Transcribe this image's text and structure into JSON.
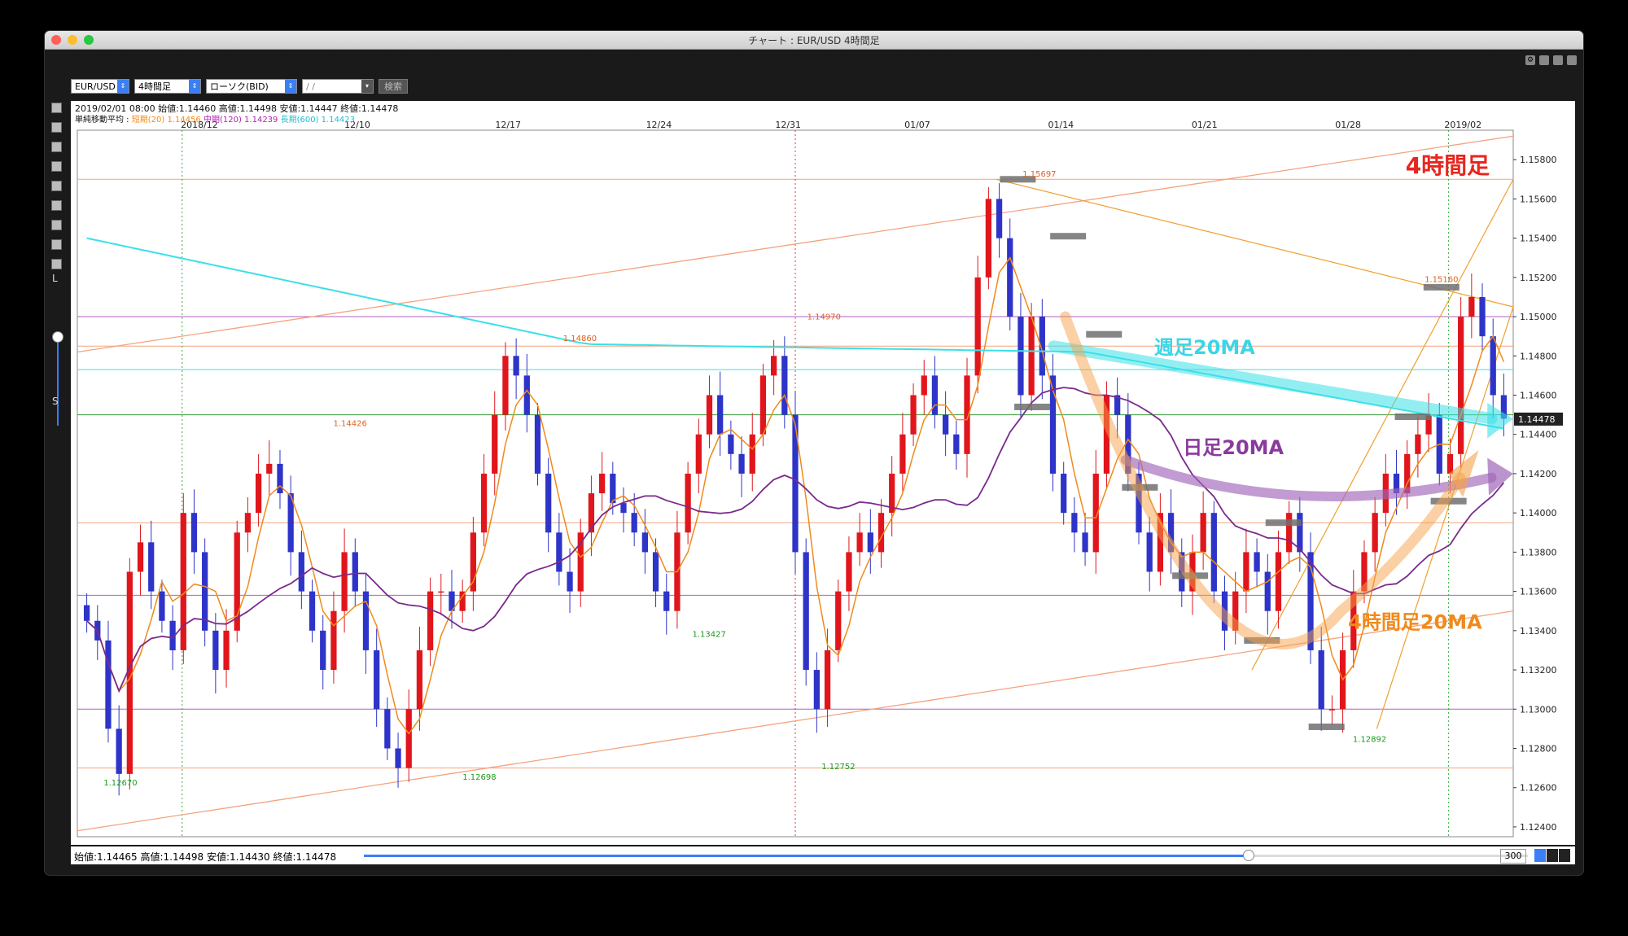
{
  "window": {
    "title": "チャート : EUR/USD 4時間足"
  },
  "toolbar": {
    "symbol": "EUR/USD",
    "timeframe": "4時間足",
    "chart_type": "ローソク(BID)",
    "date_placeholder": "/ /",
    "search_label": "検索"
  },
  "info": {
    "ohlc_line": "2019/02/01 08:00 始値:1.14460 高値:1.14498 安値:1.14447 終値:1.14478",
    "ma_prefix": "単純移動平均 : ",
    "ma_short": "短期(20) 1.14456",
    "ma_mid": "中期(120) 1.14239",
    "ma_long": "長期(600) 1.14423"
  },
  "side": {
    "label_top": "L",
    "label_bottom": "S"
  },
  "bottom": {
    "status": "始値:1.14465 高値:1.14498 安値:1.14430 終値:1.14478",
    "zoom": "300",
    "slider_position": 0.76
  },
  "colors": {
    "up": "#e0161c",
    "down": "#2e34c8",
    "ma_short": "#f08a1c",
    "ma_mid": "#7a2a8c",
    "ma_long": "#3ae0e8"
  },
  "chart_data": {
    "type": "candlestick",
    "symbol": "EUR/USD",
    "timeframe": "4時間足",
    "ylim": [
      1.1235,
      1.1595
    ],
    "y_ticks": [
      "1.15800",
      "1.15600",
      "1.15400",
      "1.15200",
      "1.15000",
      "1.14800",
      "1.14600",
      "1.14400",
      "1.14200",
      "1.14000",
      "1.13800",
      "1.13600",
      "1.13400",
      "1.13200",
      "1.13000",
      "1.12800",
      "1.12600",
      "1.12400"
    ],
    "x_ticks": [
      "2018/12",
      "12/10",
      "12/17",
      "12/24",
      "12/31",
      "01/07",
      "01/14",
      "01/21",
      "01/28",
      "2019/02"
    ],
    "current_price": "1.14478",
    "close_path": [
      1.1345,
      1.1335,
      1.129,
      1.1267,
      1.137,
      1.1385,
      1.136,
      1.1345,
      1.133,
      1.14,
      1.138,
      1.134,
      1.132,
      1.134,
      1.139,
      1.14,
      1.142,
      1.1425,
      1.141,
      1.138,
      1.136,
      1.134,
      1.132,
      1.135,
      1.138,
      1.136,
      1.133,
      1.13,
      1.128,
      1.127,
      1.13,
      1.133,
      1.136,
      1.136,
      1.135,
      1.136,
      1.139,
      1.142,
      1.145,
      1.148,
      1.147,
      1.145,
      1.142,
      1.139,
      1.137,
      1.136,
      1.139,
      1.141,
      1.142,
      1.1405,
      1.14,
      1.139,
      1.138,
      1.136,
      1.135,
      1.139,
      1.142,
      1.144,
      1.146,
      1.144,
      1.143,
      1.142,
      1.144,
      1.147,
      1.148,
      1.145,
      1.138,
      1.132,
      1.13,
      1.133,
      1.136,
      1.138,
      1.139,
      1.138,
      1.14,
      1.142,
      1.144,
      1.146,
      1.147,
      1.145,
      1.144,
      1.143,
      1.147,
      1.152,
      1.156,
      1.154,
      1.15,
      1.146,
      1.15,
      1.147,
      1.142,
      1.14,
      1.139,
      1.138,
      1.142,
      1.146,
      1.145,
      1.142,
      1.139,
      1.137,
      1.14,
      1.138,
      1.136,
      1.138,
      1.14,
      1.136,
      1.134,
      1.136,
      1.138,
      1.137,
      1.135,
      1.138,
      1.14,
      1.138,
      1.133,
      1.13,
      1.13,
      1.133,
      1.136,
      1.138,
      1.14,
      1.142,
      1.141,
      1.143,
      1.144,
      1.145,
      1.142,
      1.143,
      1.15,
      1.151,
      1.149,
      1.146,
      1.1448
    ],
    "price_labels": [
      {
        "text": "1.12670",
        "x": 0.03,
        "y": 1.1267,
        "color": "#1a9a1a",
        "pos": "below"
      },
      {
        "text": "1.14426",
        "x": 0.19,
        "y": 1.14426,
        "color": "#e06020",
        "pos": "above"
      },
      {
        "text": "1.12698",
        "x": 0.28,
        "y": 1.12698,
        "color": "#1a9a1a",
        "pos": "below"
      },
      {
        "text": "1.14860",
        "x": 0.35,
        "y": 1.1486,
        "color": "#e06020",
        "pos": "above"
      },
      {
        "text": "1.13427",
        "x": 0.44,
        "y": 1.13427,
        "color": "#1a9a1a",
        "pos": "below"
      },
      {
        "text": "1.14970",
        "x": 0.52,
        "y": 1.1497,
        "color": "#e06020",
        "pos": "above"
      },
      {
        "text": "1.12752",
        "x": 0.53,
        "y": 1.12752,
        "color": "#1a9a1a",
        "pos": "below"
      },
      {
        "text": "1.15697",
        "x": 0.67,
        "y": 1.15697,
        "color": "#e06020",
        "pos": "above"
      },
      {
        "text": "1.12892",
        "x": 0.9,
        "y": 1.12892,
        "color": "#1a9a1a",
        "pos": "below"
      },
      {
        "text": "1.15160",
        "x": 0.95,
        "y": 1.1516,
        "color": "#e06020",
        "pos": "above"
      }
    ],
    "annotations": [
      {
        "text": "4時間足",
        "color": "#e8261e"
      },
      {
        "text": "週足20MA",
        "color": "#3ad6e8"
      },
      {
        "text": "日足20MA",
        "color": "#8a3a9c"
      },
      {
        "text": "4時間足20MA",
        "color": "#f08a1c"
      }
    ]
  }
}
